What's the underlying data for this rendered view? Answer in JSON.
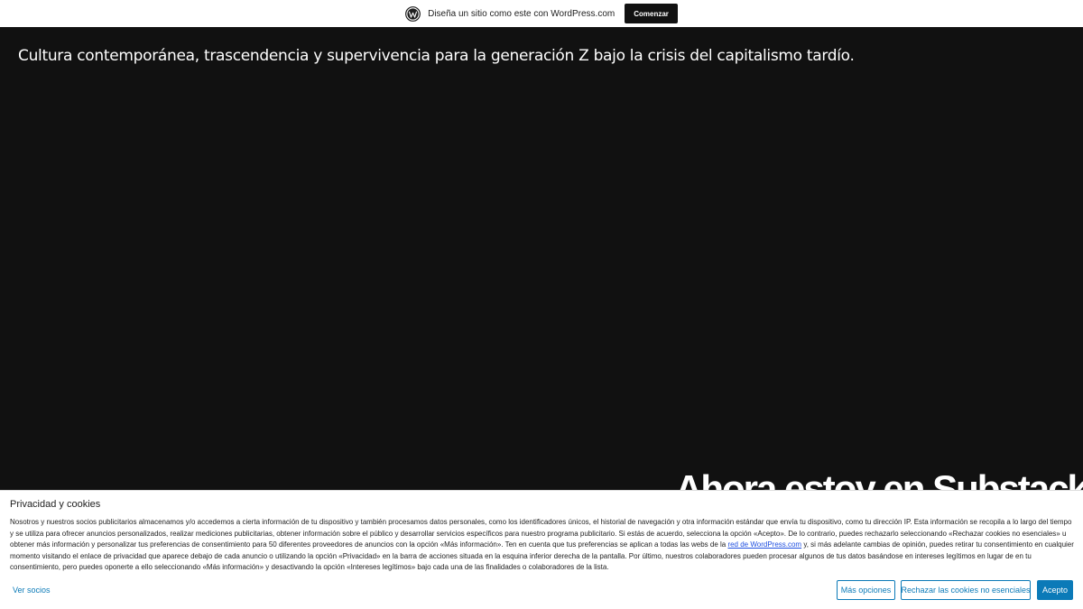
{
  "topbar": {
    "logo_icon": "wordpress-logo-icon",
    "text": "Diseña un sitio como este con WordPress.com",
    "cta_label": "Comenzar"
  },
  "site": {
    "tagline": "Cultura contemporánea, trascendencia y supervivencia para la generación Z bajo la crisis del capitalismo tardío.",
    "post_title": "Ahora estoy en Substack"
  },
  "cookie_banner": {
    "title": "Privacidad y cookies",
    "body_before_link": "Nosotros y nuestros socios publicitarios almacenamos y/o accedemos a cierta información de tu dispositivo y también procesamos datos personales, como los identificadores únicos, el historial de navegación y otra información estándar que envía tu dispositivo, como tu dirección IP. Esta información se recopila a lo largo del tiempo y se utiliza para ofrecer anuncios personalizados, realizar mediciones publicitarias, obtener información sobre el público y desarrollar servicios específicos para nuestro programa publicitario. Si estás de acuerdo, selecciona la opción «Acepto». De lo contrario, puedes rechazarlo seleccionando «Rechazar cookies no esenciales» u obtener más información y personalizar tus preferencias de consentimiento para 50 diferentes proveedores de anuncios con la opción «Más información». Ten en cuenta que tus preferencias se aplican a todas las webs de la ",
    "link_text": "red de WordPress.com",
    "body_after_link": " y, si más adelante cambias de opinión, puedes retirar tu consentimiento en cualquier momento visitando el enlace de privacidad que aparece debajo de cada anuncio o utilizando la opción «Privacidad» en la barra de acciones situada en la esquina inferior derecha de la pantalla. Por último, nuestros colaboradores pueden procesar algunos de tus datos basándose en intereses legítimos en lugar de en tu consentimiento, pero puedes oponerte a ello seleccionando «Más información» y desactivando la opción «Intereses legítimos» bajo cada una de las finalidades o colaboradores de la lista.",
    "partners_label": "Ver socios",
    "more_options_label": "Más opciones",
    "reject_label": "Rechazar las cookies no esenciales",
    "accept_label": "Acepto",
    "accent_color": "#0b7ab8"
  }
}
